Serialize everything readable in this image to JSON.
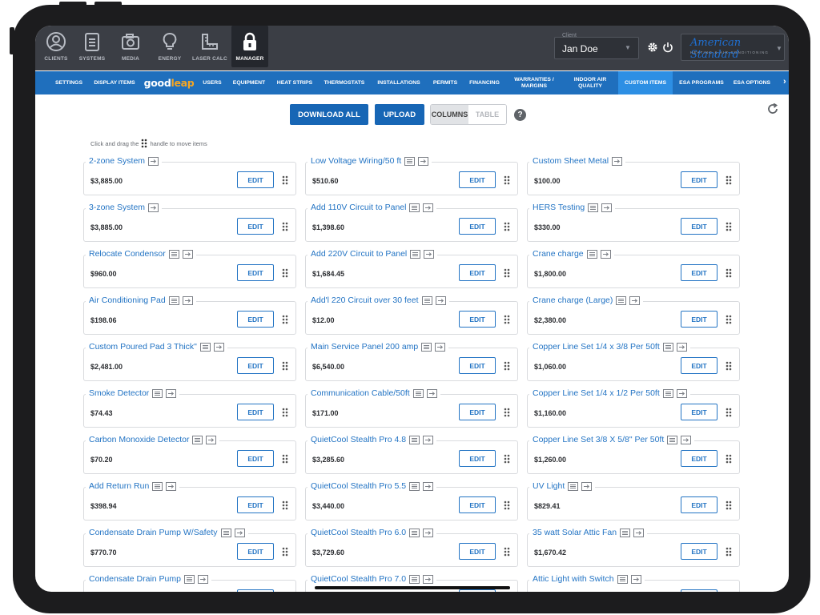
{
  "nav": {
    "items": [
      {
        "label": "CLIENTS",
        "icon": "user-circle-icon"
      },
      {
        "label": "SYSTEMS",
        "icon": "clipboard-list-icon"
      },
      {
        "label": "MEDIA",
        "icon": "camera-icon"
      },
      {
        "label": "ENERGY",
        "icon": "lightbulb-icon"
      },
      {
        "label": "LASER CALC",
        "icon": "ruler-square-icon"
      },
      {
        "label": "MANAGER",
        "icon": "lock-icon",
        "active": true
      }
    ]
  },
  "client": {
    "label": "Client",
    "name": "Jan Doe"
  },
  "brand": {
    "name": "American Standard",
    "sub": "HEATING & AIR CONDITIONING"
  },
  "subnav": {
    "items": [
      "SETTINGS",
      "DISPLAY ITEMS",
      "goodleap",
      "USERS",
      "EQUIPMENT",
      "HEAT STRIPS",
      "THERMOSTATS",
      "INSTALLATIONS",
      "PERMITS",
      "FINANCING",
      "WARRANTIES / MARGINS",
      "INDOOR AIR QUALITY",
      "CUSTOM ITEMS",
      "ESA PROGRAMS",
      "ESA OPTIONS"
    ],
    "goodleap_a": "good",
    "goodleap_b": "leap",
    "active": "CUSTOM ITEMS"
  },
  "toolbar": {
    "download_label": "DOWNLOAD ALL",
    "upload_label": "UPLOAD",
    "columns_label": "COLUMNS",
    "table_label": "TABLE",
    "help_label": "?"
  },
  "hint": {
    "before": "Click and drag the",
    "after": "handle to move items"
  },
  "edit_label": "EDIT",
  "columns": [
    [
      {
        "name": "2-zone System",
        "price": "$3,885.00",
        "list_icon": false
      },
      {
        "name": "3-zone System",
        "price": "$3,885.00",
        "list_icon": false
      },
      {
        "name": "Relocate Condensor",
        "price": "$960.00",
        "list_icon": true
      },
      {
        "name": "Air Conditioning Pad",
        "price": "$198.06",
        "list_icon": true
      },
      {
        "name": "Custom Poured Pad 3 Thick\"",
        "price": "$2,481.00",
        "list_icon": true
      },
      {
        "name": "Smoke Detector",
        "price": "$74.43",
        "list_icon": true
      },
      {
        "name": "Carbon Monoxide Detector",
        "price": "$70.20",
        "list_icon": true
      },
      {
        "name": "Add Return Run",
        "price": "$398.94",
        "list_icon": true
      },
      {
        "name": "Condensate Drain Pump W/Safety",
        "price": "$770.70",
        "list_icon": true
      },
      {
        "name": "Condensate Drain Pump",
        "price": "",
        "list_icon": true
      }
    ],
    [
      {
        "name": "Low Voltage Wiring/50 ft",
        "price": "$510.60",
        "list_icon": true
      },
      {
        "name": "Add 110V Circuit to Panel",
        "price": "$1,398.60",
        "list_icon": true
      },
      {
        "name": "Add 220V Circuit to Panel",
        "price": "$1,684.45",
        "list_icon": true
      },
      {
        "name": "Add'l 220 Circuit over 30 feet",
        "price": "$12.00",
        "list_icon": true
      },
      {
        "name": "Main Service Panel 200 amp",
        "price": "$6,540.00",
        "list_icon": true
      },
      {
        "name": "Communication Cable/50ft",
        "price": "$171.00",
        "list_icon": true
      },
      {
        "name": "QuietCool Stealth Pro 4.8",
        "price": "$3,285.60",
        "list_icon": true
      },
      {
        "name": "QuietCool Stealth Pro 5.5",
        "price": "$3,440.00",
        "list_icon": true
      },
      {
        "name": "QuietCool Stealth Pro 6.0",
        "price": "$3,729.60",
        "list_icon": true
      },
      {
        "name": "QuietCool Stealth Pro 7.0",
        "price": "",
        "list_icon": true
      }
    ],
    [
      {
        "name": "Custom Sheet Metal",
        "price": "$100.00",
        "list_icon": false
      },
      {
        "name": "HERS Testing",
        "price": "$330.00",
        "list_icon": true
      },
      {
        "name": "Crane charge",
        "price": "$1,800.00",
        "list_icon": true
      },
      {
        "name": "Crane charge (Large)",
        "price": "$2,380.00",
        "list_icon": true
      },
      {
        "name": "Copper Line Set 1/4 x 3/8 Per 50ft",
        "price": "$1,060.00",
        "list_icon": true
      },
      {
        "name": "Copper Line Set 1/4 x 1/2 Per 50ft",
        "price": "$1,160.00",
        "list_icon": true
      },
      {
        "name": "Copper Line Set 3/8 X 5/8\" Per 50ft",
        "price": "$1,260.00",
        "list_icon": true
      },
      {
        "name": "UV Light",
        "price": "$829.41",
        "list_icon": true
      },
      {
        "name": "35 watt Solar Attic Fan",
        "price": "$1,670.42",
        "list_icon": true
      },
      {
        "name": "Attic Light with Switch",
        "price": "",
        "list_icon": true
      }
    ]
  ]
}
